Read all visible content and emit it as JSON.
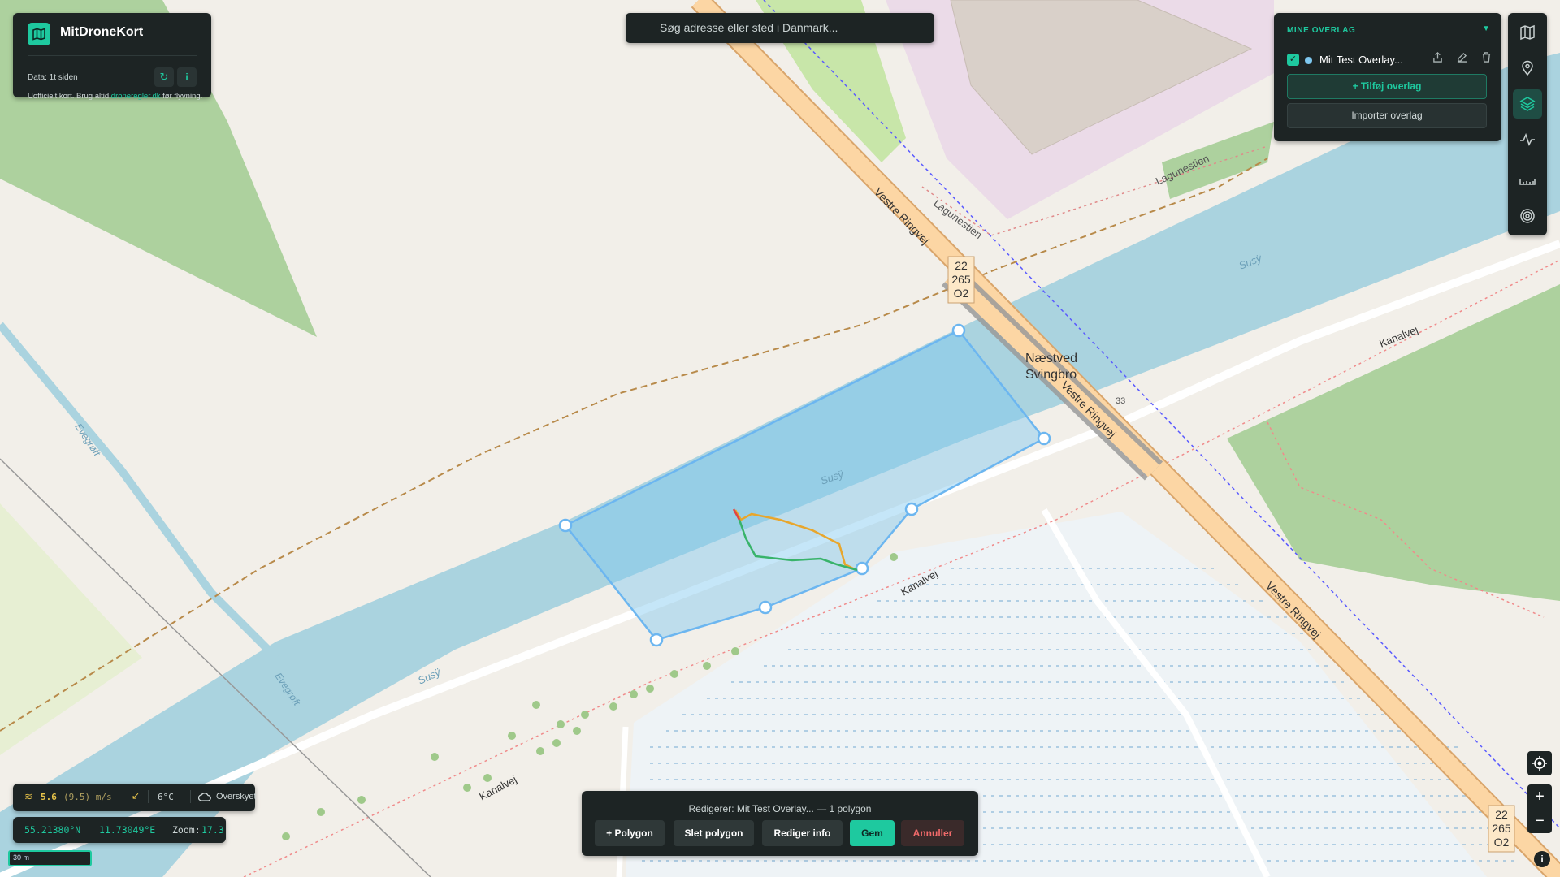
{
  "app": {
    "title": "MitDroneKort",
    "data_age": "Data: 1t siden",
    "note_pre": "Uofficielt kort. Brug altid ",
    "note_link": "droneregler.dk",
    "note_post": " før flyvning."
  },
  "search": {
    "placeholder": "Søg adresse eller sted i Danmark..."
  },
  "overlays": {
    "header": "MINE OVERLAG",
    "items": [
      {
        "name": "Mit Test Overlay...",
        "checked": true,
        "color": "#7ec8f0"
      }
    ],
    "add_label": "+ Tilføj overlag",
    "import_label": "Importer overlag"
  },
  "toolbar": {
    "buttons": [
      {
        "icon": "map-icon",
        "active": false
      },
      {
        "icon": "pin-icon",
        "active": false
      },
      {
        "icon": "layers-icon",
        "active": true
      },
      {
        "icon": "activity-icon",
        "active": false
      },
      {
        "icon": "ruler-icon",
        "active": false
      },
      {
        "icon": "target-icon",
        "active": false
      }
    ]
  },
  "map": {
    "labels": {
      "vestre_ringvej": "Vestre Ringvej",
      "lagunestien": "Lagunestien",
      "suso": "Susÿ",
      "naestved": "Næstved",
      "svingbro": "Svingbro",
      "kanalvej": "Kanalvej",
      "evegroft": "Evegrøft",
      "road_ref_1": "22",
      "road_ref_2": "265",
      "road_ref_3": "O2",
      "road_33": "33"
    }
  },
  "status": {
    "wind": "5.6",
    "gust": "(9.5) m/s",
    "temp": "6°C",
    "weather": "Overskyet",
    "lat": "55.21380°N",
    "lon": "11.73049°E",
    "zoom_label": "Zoom:",
    "zoom": "17.3",
    "scale": "30 m"
  },
  "editor": {
    "label": "Redigerer: Mit Test Overlay... — 1 polygon",
    "add_polygon": "+ Polygon",
    "delete_polygon": "Slet polygon",
    "edit_info": "Rediger info",
    "save": "Gem",
    "cancel": "Annuller"
  },
  "colors": {
    "accent": "#1ec99f",
    "panel": "#1d2424",
    "water": "#aad3df",
    "polygon": "#7ec8f0",
    "cancel": "#e05555"
  }
}
